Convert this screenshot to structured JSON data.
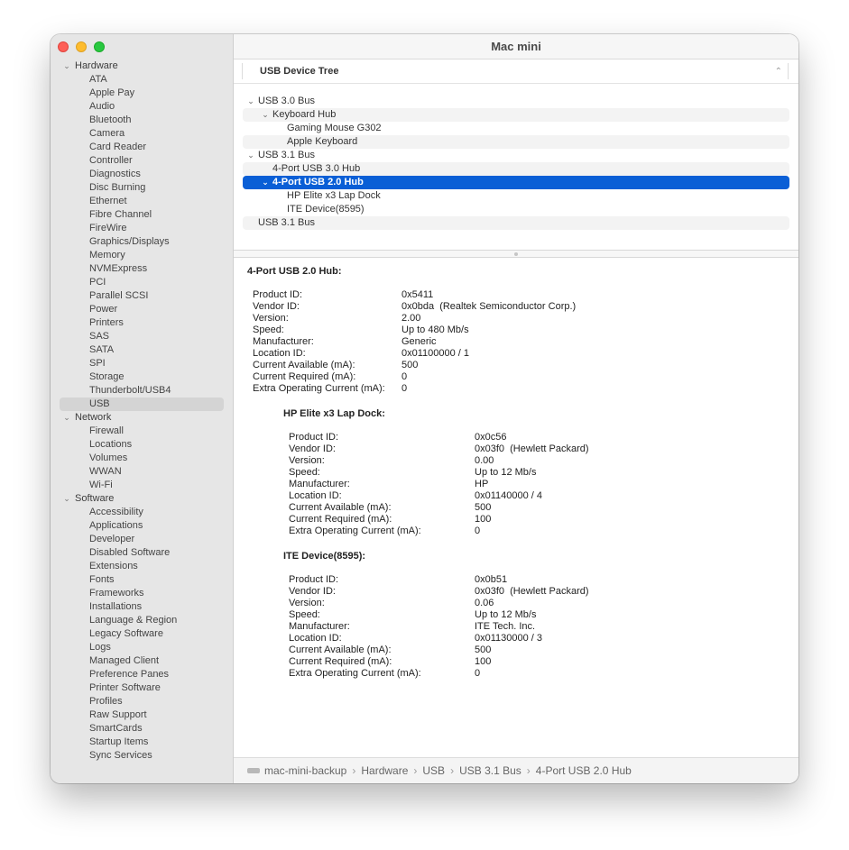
{
  "window": {
    "title": "Mac mini"
  },
  "sidebar": {
    "groups": [
      {
        "label": "Hardware",
        "items": [
          "ATA",
          "Apple Pay",
          "Audio",
          "Bluetooth",
          "Camera",
          "Card Reader",
          "Controller",
          "Diagnostics",
          "Disc Burning",
          "Ethernet",
          "Fibre Channel",
          "FireWire",
          "Graphics/Displays",
          "Memory",
          "NVMExpress",
          "PCI",
          "Parallel SCSI",
          "Power",
          "Printers",
          "SAS",
          "SATA",
          "SPI",
          "Storage",
          "Thunderbolt/USB4",
          "USB"
        ]
      },
      {
        "label": "Network",
        "items": [
          "Firewall",
          "Locations",
          "Volumes",
          "WWAN",
          "Wi-Fi"
        ]
      },
      {
        "label": "Software",
        "items": [
          "Accessibility",
          "Applications",
          "Developer",
          "Disabled Software",
          "Extensions",
          "Fonts",
          "Frameworks",
          "Installations",
          "Language & Region",
          "Legacy Software",
          "Logs",
          "Managed Client",
          "Preference Panes",
          "Printer Software",
          "Profiles",
          "Raw Support",
          "SmartCards",
          "Startup Items",
          "Sync Services"
        ]
      }
    ],
    "selected": "USB"
  },
  "tree": {
    "header": "USB Device Tree",
    "rows": [
      {
        "label": "USB 3.0 Bus",
        "level": 0,
        "expandable": true,
        "alt": false,
        "selected": false
      },
      {
        "label": "Keyboard Hub",
        "level": 1,
        "expandable": true,
        "alt": true,
        "selected": false
      },
      {
        "label": "Gaming Mouse G302",
        "level": 2,
        "expandable": false,
        "alt": false,
        "selected": false
      },
      {
        "label": "Apple Keyboard",
        "level": 2,
        "expandable": false,
        "alt": true,
        "selected": false
      },
      {
        "label": "USB 3.1 Bus",
        "level": 0,
        "expandable": true,
        "alt": false,
        "selected": false
      },
      {
        "label": "4-Port USB 3.0 Hub",
        "level": 1,
        "expandable": false,
        "alt": true,
        "selected": false
      },
      {
        "label": "4-Port USB 2.0 Hub",
        "level": 1,
        "expandable": true,
        "alt": false,
        "selected": true
      },
      {
        "label": "HP Elite x3 Lap Dock",
        "level": 2,
        "expandable": false,
        "alt": false,
        "selected": false
      },
      {
        "label": "ITE Device(8595)",
        "level": 2,
        "expandable": false,
        "alt": false,
        "selected": false
      },
      {
        "label": "USB 3.1 Bus",
        "level": 0,
        "expandable": false,
        "alt": true,
        "selected": false
      }
    ]
  },
  "detail": {
    "title": "4-Port USB 2.0 Hub:",
    "fields": [
      [
        "Product ID:",
        "0x5411"
      ],
      [
        "Vendor ID:",
        "0x0bda  (Realtek Semiconductor Corp.)"
      ],
      [
        "Version:",
        "2.00"
      ],
      [
        "Speed:",
        "Up to 480 Mb/s"
      ],
      [
        "Manufacturer:",
        "Generic"
      ],
      [
        "Location ID:",
        "0x01100000 / 1"
      ],
      [
        "Current Available (mA):",
        "500"
      ],
      [
        "Current Required (mA):",
        "0"
      ],
      [
        "Extra Operating Current (mA):",
        "0"
      ]
    ],
    "children": [
      {
        "title": "HP Elite x3 Lap Dock:",
        "fields": [
          [
            "Product ID:",
            "0x0c56"
          ],
          [
            "Vendor ID:",
            "0x03f0  (Hewlett Packard)"
          ],
          [
            "Version:",
            "0.00"
          ],
          [
            "Speed:",
            "Up to 12 Mb/s"
          ],
          [
            "Manufacturer:",
            "HP"
          ],
          [
            "Location ID:",
            "0x01140000 / 4"
          ],
          [
            "Current Available (mA):",
            "500"
          ],
          [
            "Current Required (mA):",
            "100"
          ],
          [
            "Extra Operating Current (mA):",
            "0"
          ]
        ]
      },
      {
        "title": "ITE Device(8595):",
        "fields": [
          [
            "Product ID:",
            "0x0b51"
          ],
          [
            "Vendor ID:",
            "0x03f0  (Hewlett Packard)"
          ],
          [
            "Version:",
            "0.06"
          ],
          [
            "Speed:",
            "Up to 12 Mb/s"
          ],
          [
            "Manufacturer:",
            "ITE Tech. Inc."
          ],
          [
            "Location ID:",
            "0x01130000 / 3"
          ],
          [
            "Current Available (mA):",
            "500"
          ],
          [
            "Current Required (mA):",
            "100"
          ],
          [
            "Extra Operating Current (mA):",
            "0"
          ]
        ]
      }
    ]
  },
  "footer": {
    "icon": "mac-mini-icon",
    "path": [
      "mac-mini-backup",
      "Hardware",
      "USB",
      "USB 3.1 Bus",
      "4-Port USB 2.0 Hub"
    ]
  },
  "colors": {
    "selection": "#0a5fd6",
    "close": "#fe5f57",
    "minimize": "#febc2e",
    "zoom": "#28c840"
  }
}
